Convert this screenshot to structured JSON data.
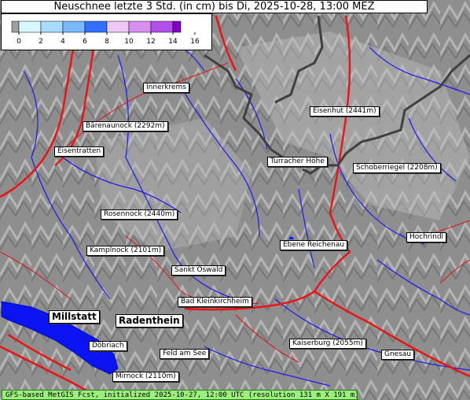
{
  "title": "Neuschnee letzte 3 Std. (in cm) bis Di, 2025-10-28, 13:00 MEZ",
  "legend": {
    "ticks": [
      "0",
      "2",
      "4",
      "6",
      "8",
      "10",
      "12",
      "14",
      "16"
    ],
    "colors": [
      "#a0a0a0",
      "#d8f8ff",
      "#a8dcff",
      "#78b8ff",
      "#3070ff",
      "#f0c8f8",
      "#d890f0",
      "#b050e8",
      "#8000c8"
    ]
  },
  "places": [
    {
      "name": "Innerkrems",
      "big": false
    },
    {
      "name": "Bärenaunock (2292m)",
      "big": false
    },
    {
      "name": "Eisentratten",
      "big": false
    },
    {
      "name": "Eisenhut (2441m)",
      "big": false
    },
    {
      "name": "Turracher Höhe",
      "big": false
    },
    {
      "name": "Schoberriegel (2208m)",
      "big": false
    },
    {
      "name": "Rosennock (2440m)",
      "big": false
    },
    {
      "name": "Hochrindl",
      "big": false
    },
    {
      "name": "Kamplnock (2101m)",
      "big": false
    },
    {
      "name": "Ebene Reichenau",
      "big": false
    },
    {
      "name": "Sankt Oswald",
      "big": false
    },
    {
      "name": "Bad Kleinkirchheim",
      "big": false
    },
    {
      "name": "Millstatt",
      "big": true
    },
    {
      "name": "Radenthein",
      "big": true
    },
    {
      "name": "Döbriach",
      "big": false
    },
    {
      "name": "Kaiserburg (2055m)",
      "big": false
    },
    {
      "name": "Feld am See",
      "big": false
    },
    {
      "name": "Gnesau",
      "big": false
    },
    {
      "name": "Mirnock (2110m)",
      "big": false
    }
  ],
  "footer": "GFS-based MetGIS Fcst, initialized 2025-10-27, 12:00 UTC  (resolution 131 m X 191 m)"
}
